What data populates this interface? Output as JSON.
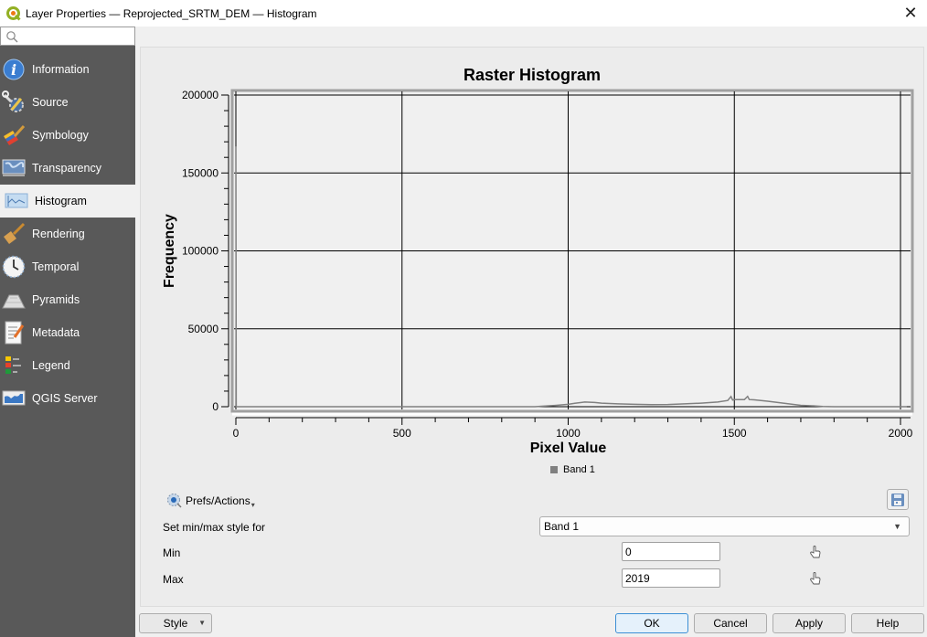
{
  "window": {
    "title": "Layer Properties — Reprojected_SRTM_DEM — Histogram",
    "close_icon": "close-icon"
  },
  "sidebar": {
    "search": {
      "value": "",
      "placeholder": ""
    },
    "items": [
      {
        "label": "Information",
        "icon": "info-icon",
        "active": false
      },
      {
        "label": "Source",
        "icon": "source-tools-icon",
        "active": false
      },
      {
        "label": "Symbology",
        "icon": "symbology-brush-icon",
        "active": false
      },
      {
        "label": "Transparency",
        "icon": "transparency-map-icon",
        "active": false
      },
      {
        "label": "Histogram",
        "icon": "histogram-icon",
        "active": true
      },
      {
        "label": "Rendering",
        "icon": "rendering-brush-icon",
        "active": false
      },
      {
        "label": "Temporal",
        "icon": "clock-icon",
        "active": false
      },
      {
        "label": "Pyramids",
        "icon": "pyramids-icon",
        "active": false
      },
      {
        "label": "Metadata",
        "icon": "metadata-document-icon",
        "active": false
      },
      {
        "label": "Legend",
        "icon": "legend-icon",
        "active": false
      },
      {
        "label": "QGIS Server",
        "icon": "qgis-server-icon",
        "active": false
      }
    ]
  },
  "colors": {
    "sidebar_bg": "#595959",
    "series": "#808080",
    "grid": "#000000",
    "accent": "#3c8fd5"
  },
  "chart_data": {
    "type": "line",
    "title": "Raster Histogram",
    "xlabel": "Pixel Value",
    "ylabel": "Frequency",
    "xlim": [
      0,
      2019
    ],
    "ylim": [
      0,
      200000
    ],
    "x_ticks": [
      0,
      500,
      1000,
      1500,
      2000
    ],
    "y_ticks": [
      0,
      50000,
      100000,
      150000,
      200000
    ],
    "x_tick_labels": [
      "0",
      "500",
      "1000",
      "1500",
      "2000"
    ],
    "y_tick_labels": [
      "0",
      "50000",
      "100000",
      "150000",
      "200000"
    ],
    "grid": true,
    "legend": {
      "position": "bottom-center",
      "entries": [
        "Band 1"
      ]
    },
    "series": [
      {
        "name": "Band 1",
        "x": [
          0,
          1,
          2,
          10,
          100,
          500,
          900,
          920,
          960,
          1000,
          1020,
          1050,
          1080,
          1100,
          1150,
          1200,
          1250,
          1300,
          1350,
          1400,
          1450,
          1480,
          1490,
          1495,
          1500,
          1530,
          1540,
          1545,
          1560,
          1600,
          1650,
          1700,
          1740,
          1766,
          1800,
          1900,
          2000,
          2019
        ],
        "values": [
          167000,
          0,
          0,
          0,
          0,
          0,
          0,
          300,
          800,
          1500,
          2200,
          3000,
          2700,
          2300,
          1800,
          1500,
          1300,
          1400,
          1800,
          2300,
          3000,
          4000,
          6500,
          4200,
          4500,
          4500,
          6600,
          4600,
          4400,
          3500,
          2200,
          900,
          500,
          200,
          0,
          0,
          0,
          0
        ]
      }
    ]
  },
  "controls": {
    "prefs_label": "Prefs/Actions",
    "set_minmax_label": "Set min/max style for",
    "band_select_value": "Band 1",
    "min_label": "Min",
    "min_value": "0",
    "max_label": "Max",
    "max_value": "2019"
  },
  "footer": {
    "style_label": "Style",
    "ok_label": "OK",
    "cancel_label": "Cancel",
    "apply_label": "Apply",
    "help_label": "Help"
  }
}
